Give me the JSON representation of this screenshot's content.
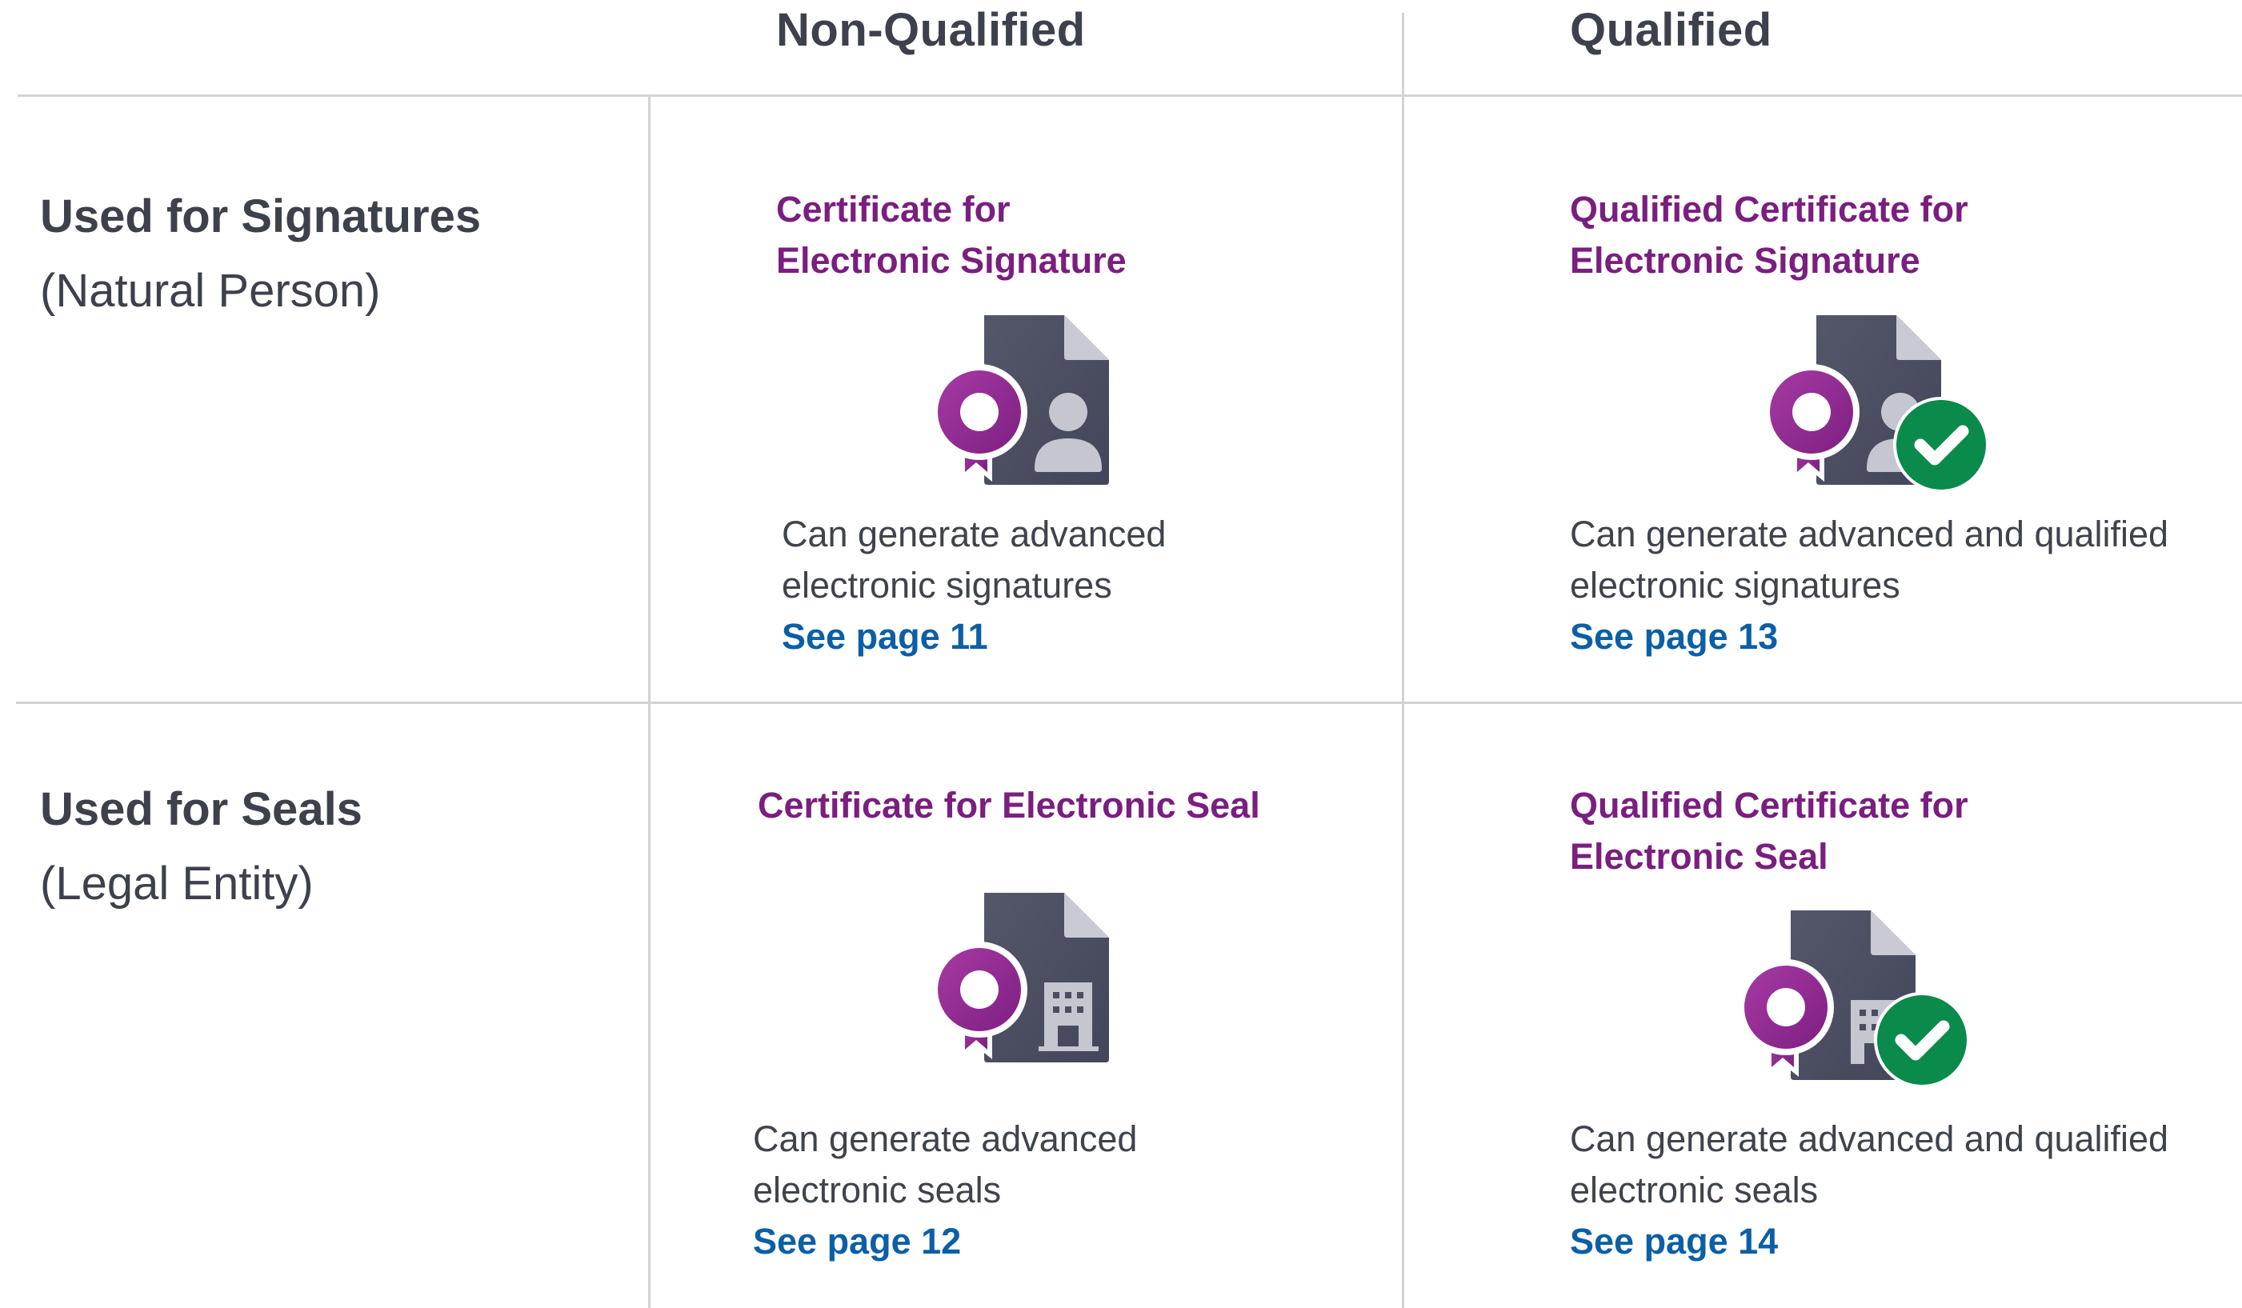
{
  "columns": {
    "non_qualified": "Non-Qualified",
    "qualified": "Qualified"
  },
  "rows": [
    {
      "title": "Used for Signatures",
      "subtitle": "(Natural Person)",
      "cells": [
        {
          "title": "Certificate for\nElectronic Signature",
          "icon": "document-ribbon-person-icon",
          "desc_line1": "Can generate advanced",
          "desc_line2": "electronic signatures",
          "link": "See page 11"
        },
        {
          "title": "Qualified Certificate for\nElectronic Signature",
          "icon": "document-ribbon-person-check-icon",
          "desc_line1": "Can generate advanced and qualified",
          "desc_line2": "electronic signatures",
          "link": "See page 13"
        }
      ]
    },
    {
      "title": "Used for Seals",
      "subtitle": "(Legal Entity)",
      "cells": [
        {
          "title": "Certificate for Electronic Seal",
          "icon": "document-ribbon-building-icon",
          "desc_line1": "Can generate advanced",
          "desc_line2": "electronic seals",
          "link": "See page 12"
        },
        {
          "title": "Qualified Certificate for\nElectronic Seal",
          "icon": "document-ribbon-building-check-icon",
          "desc_line1": "Can generate advanced and qualified",
          "desc_line2": "electronic seals",
          "link": "See page 14"
        }
      ]
    }
  ],
  "colors": {
    "title_purple": "#7a1e7f",
    "link_blue": "#0c5fa6",
    "text_dark": "#3f434c",
    "check_green": "#0a8a4b",
    "document_slate": "#4b4e61"
  }
}
